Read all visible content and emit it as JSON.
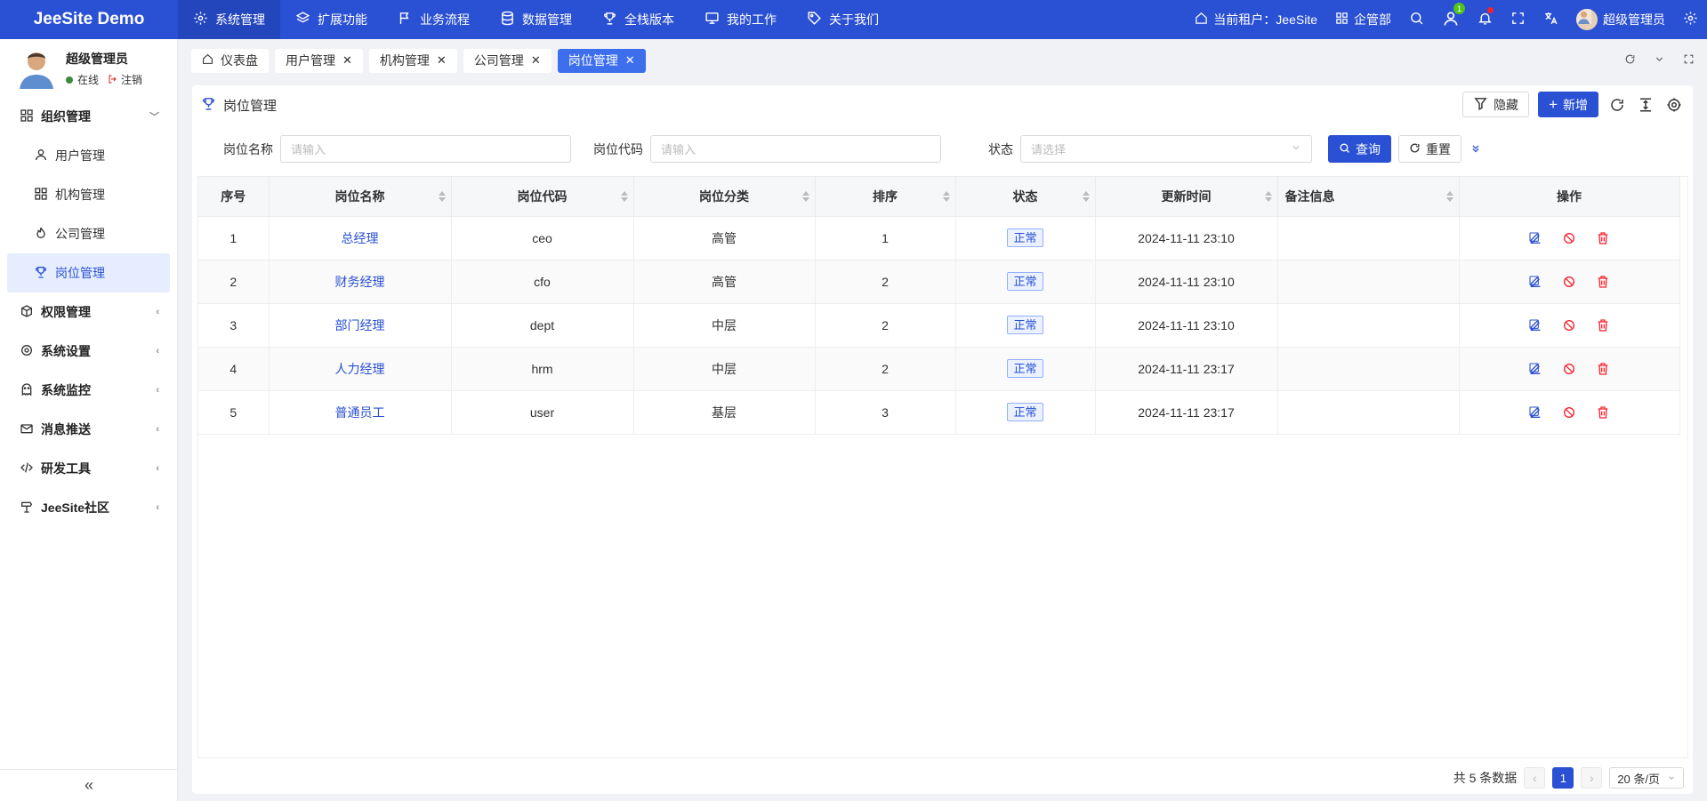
{
  "app": {
    "logo": "JeeSite Demo"
  },
  "topnav": [
    {
      "label": "系统管理",
      "icon": "gear-icon",
      "active": true
    },
    {
      "label": "扩展功能",
      "icon": "layers-icon"
    },
    {
      "label": "业务流程",
      "icon": "flag-icon"
    },
    {
      "label": "数据管理",
      "icon": "database-icon"
    },
    {
      "label": "全栈版本",
      "icon": "trophy-icon"
    },
    {
      "label": "我的工作",
      "icon": "monitor-icon"
    },
    {
      "label": "关于我们",
      "icon": "tag-icon"
    }
  ],
  "header_right": {
    "tenant": "当前租户：JeeSite",
    "org": "企管部",
    "user_badge": "1",
    "username": "超级管理员"
  },
  "sidebar": {
    "user_name": "超级管理员",
    "status_online": "在线",
    "status_logout": "注销",
    "items": [
      {
        "label": "组织管理",
        "icon": "grid-icon",
        "type": "group",
        "expanded": true
      },
      {
        "label": "用户管理",
        "icon": "user-icon",
        "type": "sub"
      },
      {
        "label": "机构管理",
        "icon": "grid-icon",
        "type": "sub"
      },
      {
        "label": "公司管理",
        "icon": "fire-icon",
        "type": "sub"
      },
      {
        "label": "岗位管理",
        "icon": "trophy-icon",
        "type": "sub",
        "active": true
      },
      {
        "label": "权限管理",
        "icon": "cube-icon",
        "type": "group"
      },
      {
        "label": "系统设置",
        "icon": "gear-icon",
        "type": "group"
      },
      {
        "label": "系统监控",
        "icon": "ghost-icon",
        "type": "group"
      },
      {
        "label": "消息推送",
        "icon": "mail-icon",
        "type": "group"
      },
      {
        "label": "研发工具",
        "icon": "code-icon",
        "type": "group"
      },
      {
        "label": "JeeSite社区",
        "icon": "signpost-icon",
        "type": "group"
      }
    ]
  },
  "tabs": [
    {
      "label": "仪表盘",
      "icon": "home-icon",
      "closable": false
    },
    {
      "label": "用户管理",
      "closable": true
    },
    {
      "label": "机构管理",
      "closable": true
    },
    {
      "label": "公司管理",
      "closable": true
    },
    {
      "label": "岗位管理",
      "closable": true,
      "active": true
    }
  ],
  "panel": {
    "title": "岗位管理",
    "hide_label": "隐藏",
    "add_label": "新增"
  },
  "search": {
    "name_label": "岗位名称",
    "name_placeholder": "请输入",
    "code_label": "岗位代码",
    "code_placeholder": "请输入",
    "status_label": "状态",
    "status_placeholder": "请选择",
    "query_label": "查询",
    "reset_label": "重置"
  },
  "table": {
    "columns": [
      "序号",
      "岗位名称",
      "岗位代码",
      "岗位分类",
      "排序",
      "状态",
      "更新时间",
      "备注信息",
      "操作"
    ],
    "rows": [
      {
        "idx": "1",
        "name": "总经理",
        "code": "ceo",
        "category": "高管",
        "sort": "1",
        "status": "正常",
        "updated": "2024-11-11 23:10",
        "remark": ""
      },
      {
        "idx": "2",
        "name": "财务经理",
        "code": "cfo",
        "category": "高管",
        "sort": "2",
        "status": "正常",
        "updated": "2024-11-11 23:10",
        "remark": ""
      },
      {
        "idx": "3",
        "name": "部门经理",
        "code": "dept",
        "category": "中层",
        "sort": "2",
        "status": "正常",
        "updated": "2024-11-11 23:10",
        "remark": ""
      },
      {
        "idx": "4",
        "name": "人力经理",
        "code": "hrm",
        "category": "中层",
        "sort": "2",
        "status": "正常",
        "updated": "2024-11-11 23:17",
        "remark": ""
      },
      {
        "idx": "5",
        "name": "普通员工",
        "code": "user",
        "category": "基层",
        "sort": "3",
        "status": "正常",
        "updated": "2024-11-11 23:17",
        "remark": ""
      }
    ]
  },
  "pagination": {
    "total": "共 5 条数据",
    "current": "1",
    "page_size": "20 条/页"
  },
  "colors": {
    "brand": "#2a50d3",
    "tag_border": "#91b0ff",
    "danger": "#f5222d"
  }
}
